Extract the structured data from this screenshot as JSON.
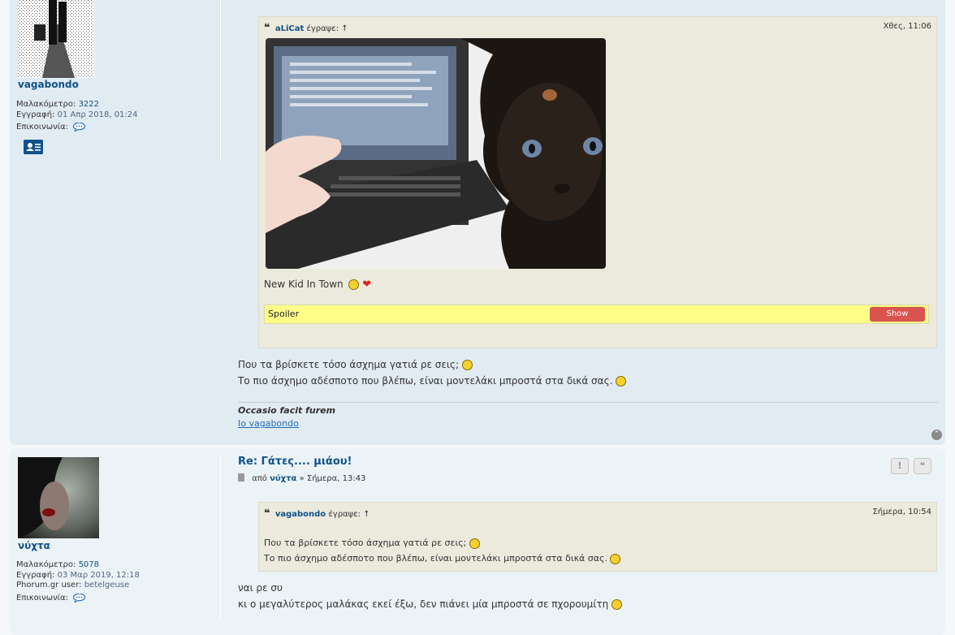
{
  "post1": {
    "author": {
      "username": "vagabondo",
      "karma_label": "Μαλακόμετρο:",
      "karma_value": "3222",
      "joined_label": "Εγγραφή:",
      "joined_value": "01 Απρ 2018, 01:24",
      "contact_label": "Επικοινωνία:"
    },
    "quote": {
      "author": "aLiCat",
      "wrote": "έγραψε:",
      "arrow": "↑",
      "date": "Χθες, 11:06",
      "caption": "New Kid In Town",
      "spoiler_label": "Spoiler",
      "spoiler_button": "Show"
    },
    "body_lines": [
      "Που τα βρίσκετε τόσο άσχημα γατιά ρε σεις;",
      "Το πιο άσχημο αδέσποτο που βλέπω, είναι μοντελάκι μπροστά στα δικά σας."
    ],
    "signature": {
      "motto": "Occasio facit furem",
      "link": "Io vagabondo"
    }
  },
  "post2": {
    "title": "Re: Γάτες.... μιάου!",
    "byline_prefix": "από",
    "byline_user": "νύχτα",
    "byline_time": "» Σήμερα, 13:43",
    "author": {
      "username": "νύχτα",
      "karma_label": "Μαλακόμετρο:",
      "karma_value": "5078",
      "joined_label": "Εγγραφή:",
      "joined_value": "03 Μαρ 2019, 12:18",
      "phorum_label": "Phorum.gr user:",
      "phorum_value": "betelgeuse",
      "contact_label": "Επικοινωνία:"
    },
    "quote": {
      "author": "vagabondo",
      "wrote": "έγραψε:",
      "arrow": "↑",
      "date": "Σήμερα, 10:54",
      "lines": [
        "Που τα βρίσκετε τόσο άσχημα γατιά ρε σεις;",
        "Το πιο άσχημο αδέσποτο που βλέπω, είναι μοντελάκι μπροστά στα δικά σας."
      ]
    },
    "body_lines": [
      "ναι ρε συ",
      "κι ο μεγαλύτερος μαλάκας εκεί έξω, δεν πιάνει μία μπροστά σε πχορουμίτη"
    ],
    "buttons": {
      "report": "!",
      "quote": "❝"
    }
  },
  "colors": {
    "post_bg_1": "#e1ebf2",
    "post_bg_2": "#ecf3f7",
    "link": "#105289",
    "quote_bg": "#ebeadd",
    "spoiler_bg": "#ffff88",
    "spoiler_button": "#d9534f"
  }
}
